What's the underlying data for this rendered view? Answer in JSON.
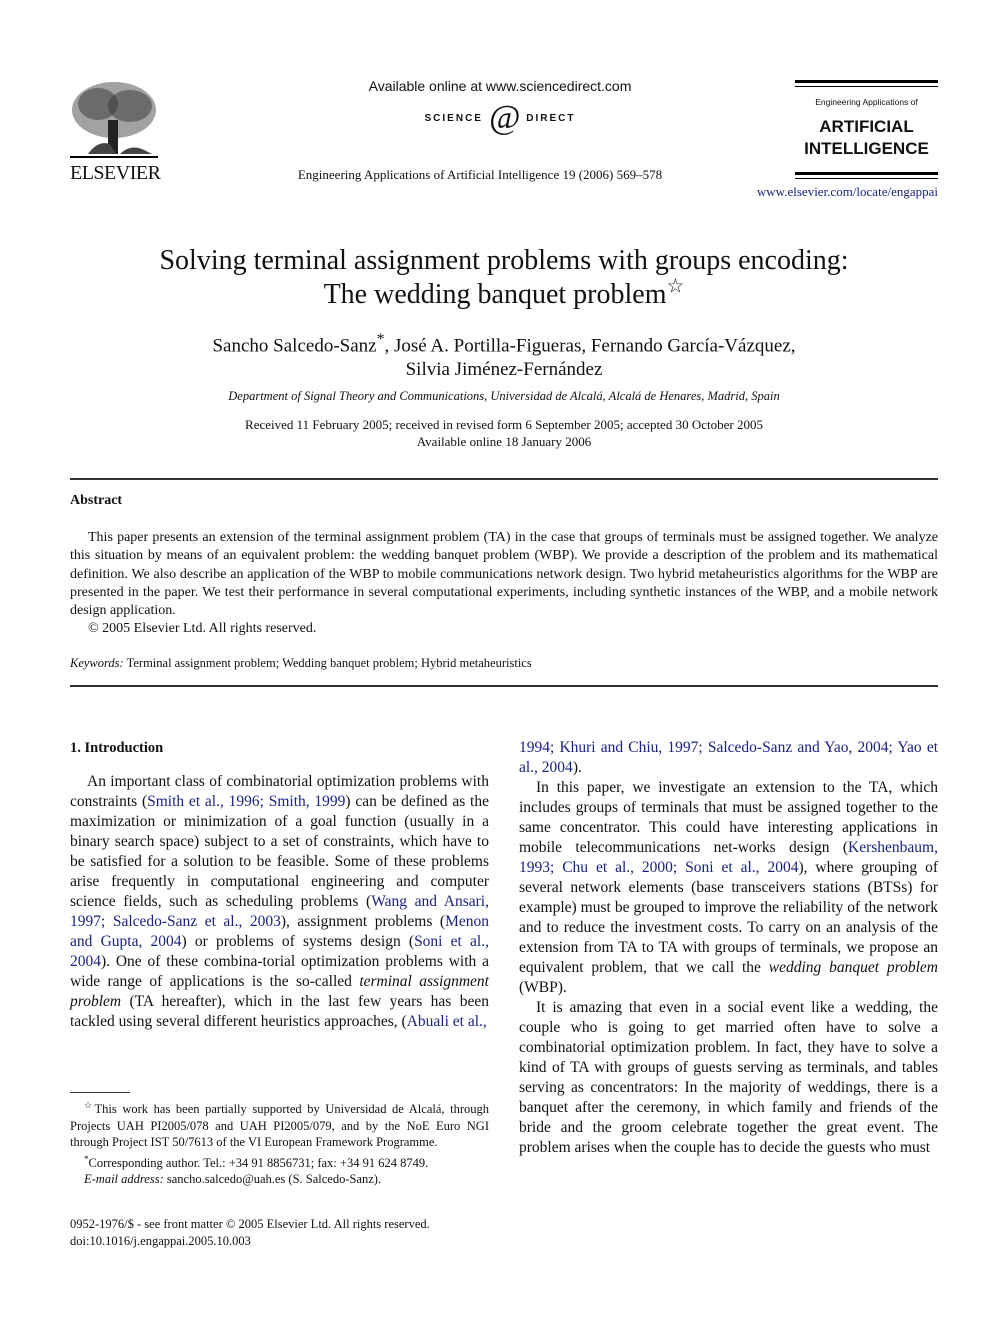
{
  "header": {
    "publisher": "ELSEVIER",
    "available_online": "Available online at www.sciencedirect.com",
    "sciencedirect_left": "SCIENCE",
    "sciencedirect_at": "d",
    "sciencedirect_right": "DIRECT",
    "sciencedirect_mark": "®",
    "journal_citation": "Engineering Applications of Artificial Intelligence 19 (2006) 569–578",
    "journal_box_sup": "Engineering Applications of",
    "journal_box_title_1": "ARTIFICIAL",
    "journal_box_title_2": "INTELLIGENCE",
    "journal_url": "www.elsevier.com/locate/engappai"
  },
  "article": {
    "title_line1": "Solving terminal assignment problems with groups encoding:",
    "title_line2": "The wedding banquet problem",
    "title_mark": "☆",
    "authors_line1_a": "Sancho Salcedo-Sanz",
    "authors_line1_mark": "*",
    "authors_line1_b": ", José A. Portilla-Figueras, Fernando García-Vázquez,",
    "authors_line2": "Silvia Jiménez-Fernández",
    "affiliation": "Department of Signal Theory and Communications, Universidad de Alcalá, Alcalá de Henares, Madrid, Spain",
    "received": "Received 11 February 2005; received in revised form 6 September 2005; accepted 30 October 2005",
    "available": "Available online 18 January 2006"
  },
  "abstract": {
    "heading": "Abstract",
    "text": "This paper presents an extension of the terminal assignment problem (TA) in the case that groups of terminals must be assigned together. We analyze this situation by means of an equivalent problem: the wedding banquet problem (WBP). We provide a description of the problem and its mathematical definition. We also describe an application of the WBP to mobile communications network design. Two hybrid metaheuristics algorithms for the WBP are presented in the paper. We test their performance in several computational experiments, including synthetic instances of the WBP, and a mobile network design application.",
    "copyright": "© 2005 Elsevier Ltd. All rights reserved.",
    "keywords_label": "Keywords:",
    "keywords": "Terminal assignment problem; Wedding banquet problem; Hybrid metaheuristics"
  },
  "intro": {
    "heading": "1.  Introduction",
    "p1": [
      {
        "t": "An important class of combinatorial optimization problems with constraints ("
      },
      {
        "t": "Smith et al., 1996; Smith, 1999",
        "cite": true
      },
      {
        "t": ") can be defined as the maximization or minimization of a goal function (usually in a binary search space) subject to a set of constraints, which have to be satisfied for a solution to be feasible. Some of these problems arise frequently in computational engineering and computer science fields, such as scheduling problems ("
      },
      {
        "t": "Wang and Ansari, 1997; Salcedo-Sanz et al., 2003",
        "cite": true
      },
      {
        "t": "), assignment problems ("
      },
      {
        "t": "Menon and Gupta, 2004",
        "cite": true
      },
      {
        "t": ") or problems of systems design ("
      },
      {
        "t": "Soni et al., 2004",
        "cite": true
      },
      {
        "t": "). One of these combina-torial optimization problems with a wide range of applications is the so-called "
      },
      {
        "t": "terminal assignment problem",
        "em": true
      },
      {
        "t": " (TA hereafter), which in the last few years has been tackled using several different heuristics approaches, ("
      },
      {
        "t": "Abuali et al., 1994; Khuri and Chiu, 1997; Salcedo-Sanz and Yao, 2004; Yao et al., 2004",
        "cite": true
      },
      {
        "t": ")."
      }
    ],
    "p2": [
      {
        "t": "In this paper, we investigate an extension to the TA, which includes groups of terminals that must be assigned together to the same concentrator. This could have interesting applications in mobile telecommunications net-works design ("
      },
      {
        "t": "Kershenbaum, 1993; Chu et al., 2000; Soni et al., 2004",
        "cite": true
      },
      {
        "t": "), where grouping of several network elements (base transceivers stations (BTSs) for example) must be grouped to improve the reliability of the network and to reduce the investment costs. To carry on an analysis of the extension from TA to TA with groups of terminals, we propose an equivalent problem, that we call the "
      },
      {
        "t": "wedding banquet problem",
        "em": true
      },
      {
        "t": " (WBP)."
      }
    ],
    "p3": [
      {
        "t": "It is amazing that even in a social event like a wedding, the couple who is going to get married often have to solve a combinatorial optimization problem. In fact, they have to solve a kind of TA with groups of guests serving as terminals, and tables serving as concentrators: In the majority of weddings, there is a banquet after the ceremony, in which family and friends of the bride and the groom celebrate together the great event. The problem arises when the couple has to decide the guests who must"
      }
    ]
  },
  "footnotes": {
    "star_mark": "☆",
    "funding": "This work has been partially supported by Universidad de Alcalá, through Projects UAH PI2005/078 and UAH PI2005/079, and by the NoE Euro NGI through Project IST 50/7613 of the VI European Framework Programme.",
    "corr_mark": "*",
    "corresponding": "Corresponding author. Tel.: +34 91 8856731; fax: +34 91 624 8749.",
    "email_label": "E-mail address:",
    "email": " sancho.salcedo@uah.es (S. Salcedo-Sanz)."
  },
  "front_matter": {
    "issn": "0952-1976/$ - see front matter © 2005 Elsevier Ltd. All rights reserved.",
    "doi": "doi:10.1016/j.engappai.2005.10.003"
  }
}
